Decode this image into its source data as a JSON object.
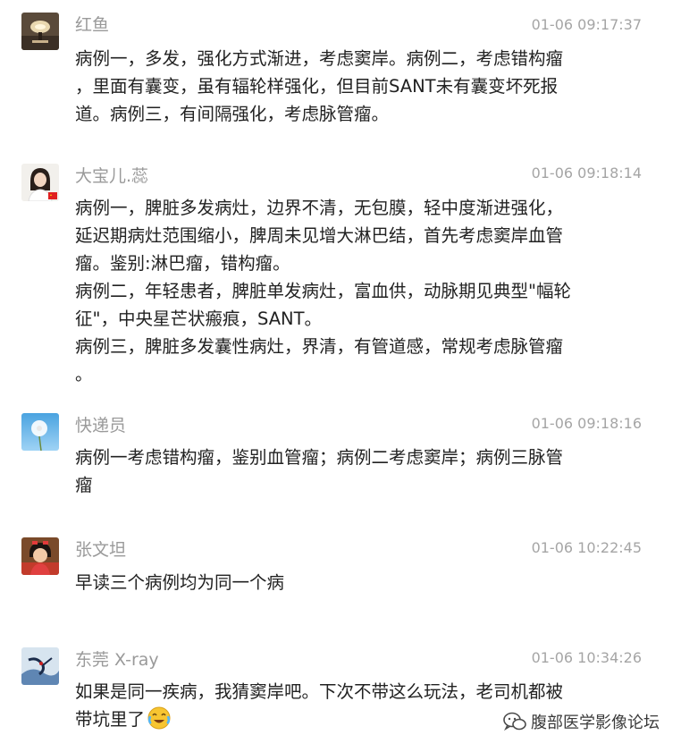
{
  "comments": [
    {
      "user": "红鱼",
      "time": "01-06 09:17:37",
      "avatar_icon": "lamp-avatar-icon",
      "text": "病例一，多发，强化方式渐进，考虑窦岸。病例二，考虑错构瘤\n，里面有囊变，虽有辐轮样强化，但目前SANT未有囊变坏死报\n道。病例三，有间隔强化，考虑脉管瘤。"
    },
    {
      "user": "大宝儿.蕊",
      "time": "01-06 09:18:14",
      "avatar_icon": "woman-avatar-icon",
      "text": "病例一，脾脏多发病灶，边界不清，无包膜，轻中度渐进强化，\n延迟期病灶范围缩小，脾周未见增大淋巴结，首先考虑窦岸血管\n瘤。鉴别:淋巴瘤，错构瘤。\n病例二，年轻患者，脾脏单发病灶，富血供，动脉期见典型\"幅轮\n征\"，中央星芒状瘢痕，SANT。\n病例三，脾脏多发囊性病灶，界清，有管道感，常规考虑脉管瘤\n。"
    },
    {
      "user": "快递员",
      "time": "01-06 09:18:16",
      "avatar_icon": "dandelion-avatar-icon",
      "text": "病例一考虑错构瘤，鉴别血管瘤；病例二考虑窦岸；病例三脉管\n瘤"
    },
    {
      "user": "张文坦",
      "time": "01-06 10:22:45",
      "avatar_icon": "child-avatar-icon",
      "text": "早读三个病例均为同一个病"
    },
    {
      "user": "东莞 X-ray",
      "time": "01-06 10:34:26",
      "avatar_icon": "bird-avatar-icon",
      "text": "如果是同一疾病，我猜窦岸吧。下次不带这么玩法，老司机都被\n带坑里了"
    }
  ],
  "watermark": "腹部医学影像论坛",
  "emoji_icon": "laugh-cry-emoji-icon",
  "colors": {
    "name": "#9a9a9a",
    "time": "#a5a5a5",
    "text": "#222222"
  }
}
